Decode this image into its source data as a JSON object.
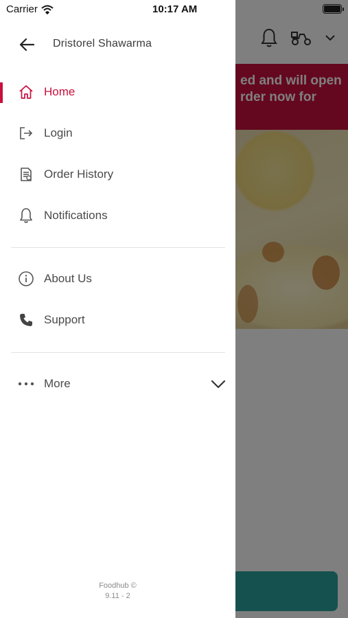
{
  "status_bar": {
    "carrier": "Carrier",
    "time": "10:17 AM"
  },
  "background_app": {
    "banner_text": "ed and will open\nrder now for",
    "accent_color": "#c8103e",
    "cta_color": "#2aa29e"
  },
  "drawer": {
    "store_name": "Dristorel Shawarma",
    "back_icon": "arrow-left-icon",
    "accent_color": "#c8103e",
    "items": [
      {
        "label": "Home",
        "icon": "home-icon",
        "active": true
      },
      {
        "label": "Login",
        "icon": "login-icon",
        "active": false
      },
      {
        "label": "Order History",
        "icon": "order-history-icon",
        "active": false
      },
      {
        "label": "Notifications",
        "icon": "bell-icon",
        "active": false
      },
      {
        "label": "About Us",
        "icon": "info-icon",
        "active": false
      },
      {
        "label": "Support",
        "icon": "phone-icon",
        "active": false
      },
      {
        "label": "More",
        "icon": "ellipsis-icon",
        "active": false
      }
    ],
    "footer": {
      "line1": "Foodhub ©",
      "line2": "9.11 - 2"
    }
  }
}
